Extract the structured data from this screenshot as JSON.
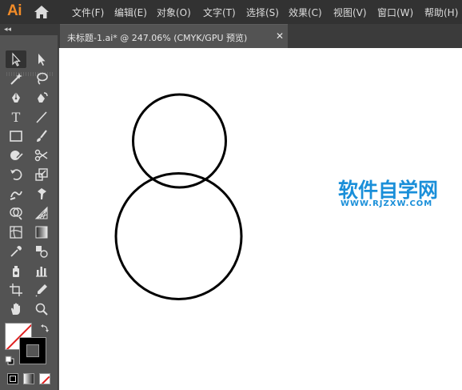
{
  "app": {
    "logo": "Ai"
  },
  "menu": {
    "items": [
      {
        "label": "文件(F)"
      },
      {
        "label": "编辑(E)"
      },
      {
        "label": "对象(O)"
      },
      {
        "label": "文字(T)"
      },
      {
        "label": "选择(S)"
      },
      {
        "label": "效果(C)"
      },
      {
        "label": "视图(V)"
      },
      {
        "label": "窗口(W)"
      },
      {
        "label": "帮助(H)"
      }
    ]
  },
  "panel": {
    "collapse_glyph": "◂◂"
  },
  "document": {
    "tab_label": "未标题-1.ai* @ 247.06% (CMYK/GPU 预览)",
    "close_glyph": "✕"
  },
  "tools": [
    {
      "icon": "selection-tool-icon"
    },
    {
      "icon": "direct-selection-tool-icon"
    },
    {
      "icon": "magic-wand-tool-icon"
    },
    {
      "icon": "lasso-tool-icon"
    },
    {
      "icon": "pen-tool-icon"
    },
    {
      "icon": "curvature-tool-icon"
    },
    {
      "icon": "type-tool-icon",
      "glyph": "T"
    },
    {
      "icon": "line-segment-tool-icon"
    },
    {
      "icon": "rectangle-tool-icon"
    },
    {
      "icon": "paintbrush-tool-icon"
    },
    {
      "icon": "shaper-tool-icon"
    },
    {
      "icon": "scissors-tool-icon"
    },
    {
      "icon": "rotate-tool-icon"
    },
    {
      "icon": "scale-tool-icon"
    },
    {
      "icon": "warp-tool-icon"
    },
    {
      "icon": "puppet-warp-tool-icon"
    },
    {
      "icon": "shape-builder-tool-icon"
    },
    {
      "icon": "perspective-grid-tool-icon"
    },
    {
      "icon": "mesh-tool-icon"
    },
    {
      "icon": "gradient-tool-icon"
    },
    {
      "icon": "eyedropper-tool-icon"
    },
    {
      "icon": "blend-tool-icon"
    },
    {
      "icon": "symbol-sprayer-tool-icon"
    },
    {
      "icon": "column-graph-tool-icon"
    },
    {
      "icon": "artboard-tool-icon"
    },
    {
      "icon": "slice-tool-icon"
    },
    {
      "icon": "hand-tool-icon"
    },
    {
      "icon": "zoom-tool-icon"
    }
  ],
  "colors": {
    "fill": "#ffffff",
    "stroke": "#000000",
    "watermark": "#1a8fd9",
    "logo": "#f28c28"
  },
  "canvas": {
    "watermark_title": "软件自学网",
    "watermark_url": "WWW.RJZXW.COM"
  }
}
